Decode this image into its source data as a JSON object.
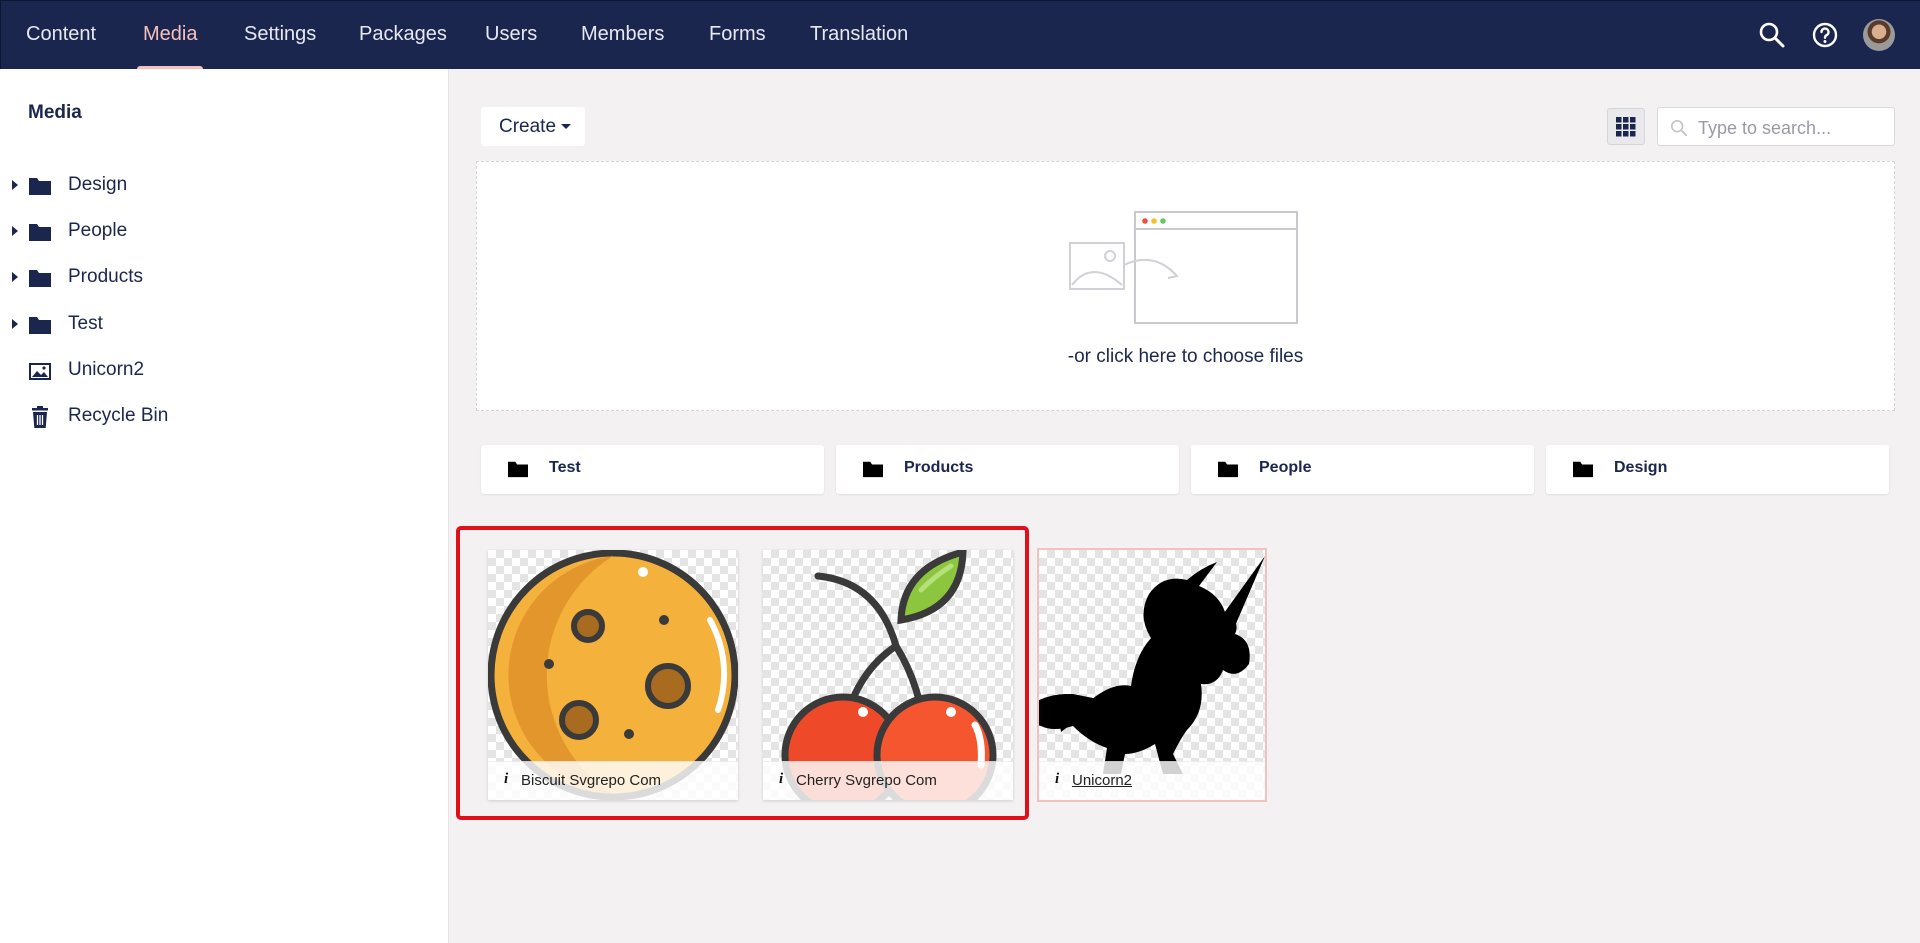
{
  "header": {
    "nav": [
      "Content",
      "Media",
      "Settings",
      "Packages",
      "Users",
      "Members",
      "Forms",
      "Translation"
    ],
    "active": "Media"
  },
  "sidebar": {
    "title": "Media",
    "items": [
      {
        "label": "Design",
        "icon": "folder-icon",
        "expandable": true
      },
      {
        "label": "People",
        "icon": "folder-icon",
        "expandable": true
      },
      {
        "label": "Products",
        "icon": "folder-icon",
        "expandable": true
      },
      {
        "label": "Test",
        "icon": "folder-icon",
        "expandable": true
      },
      {
        "label": "Unicorn2",
        "icon": "image-icon",
        "expandable": false
      },
      {
        "label": "Recycle Bin",
        "icon": "trash-icon",
        "expandable": false
      }
    ]
  },
  "toolbar": {
    "create_label": "Create",
    "search_placeholder": "Type to search..."
  },
  "dropzone": {
    "text": "-or click here to choose files"
  },
  "folders": [
    "Test",
    "Products",
    "People",
    "Design"
  ],
  "media": [
    {
      "label": "Biscuit Svgrepo Com",
      "icon": "biscuit-image"
    },
    {
      "label": "Cherry Svgrepo Com",
      "icon": "cherry-image"
    },
    {
      "label": "Unicorn2",
      "icon": "unicorn-image"
    }
  ],
  "colors": {
    "header_bg": "#1b264f",
    "active_accent": "#f5c1bc",
    "selection_border": "#e0101b"
  }
}
